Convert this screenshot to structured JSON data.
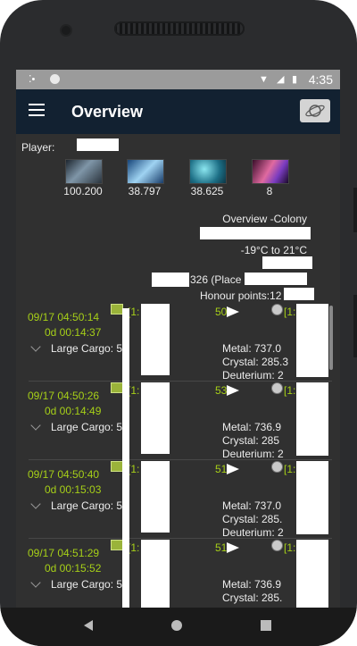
{
  "status_bar": {
    "time": "4:35"
  },
  "app_bar": {
    "title": "Overview"
  },
  "player": {
    "label": "Player:"
  },
  "resources": [
    {
      "name": "metal",
      "value": "100.200"
    },
    {
      "name": "crystal",
      "value": "38.797"
    },
    {
      "name": "deuterium",
      "value": "38.625"
    },
    {
      "name": "darkmatter",
      "value": "8"
    }
  ],
  "planet": {
    "name": "Overview -Colony",
    "temperature": "-19°C to 21°C",
    "points": "326 (Place",
    "honour_label": "Honour points:12"
  },
  "fleets": [
    {
      "arrival": "09/17 04:50:14",
      "timer": "0d 00:14:37",
      "coord_start": "[1:",
      "position": "50",
      "coord_dest": "[1:",
      "cargo": "Large Cargo: 5",
      "metal": "Metal: 737.0",
      "crystal": "Crystal: 285.3",
      "deuterium": "Deuterium: 2"
    },
    {
      "arrival": "09/17 04:50:26",
      "timer": "0d 00:14:49",
      "coord_start": "[1:",
      "position": "53",
      "coord_dest": "[1:",
      "cargo": "Large Cargo: 5",
      "metal": "Metal: 736.9",
      "crystal": "Crystal: 285",
      "deuterium": "Deuterium: 2"
    },
    {
      "arrival": "09/17 04:50:40",
      "timer": "0d 00:15:03",
      "coord_start": "[1:",
      "position": "51",
      "coord_dest": "[1:",
      "cargo": "Large Cargo: 5",
      "metal": "Metal: 737.0",
      "crystal": "Crystal: 285.",
      "deuterium": "Deuterium: 2"
    },
    {
      "arrival": "09/17 04:51:29",
      "timer": "0d 00:15:52",
      "coord_start": "[1:",
      "position": "51",
      "coord_dest": "[1:",
      "cargo": "Large Cargo: 5",
      "metal": "Metal: 736.9",
      "crystal": "Crystal: 285.",
      "deuterium": ""
    }
  ],
  "colors": {
    "app_bar": "#122131",
    "accent_green": "#a6cf18",
    "background": "#303030"
  },
  "icons": {
    "menu": "hamburger-icon",
    "planet": "planet-ring-icon",
    "ship": "ship-icon",
    "mission": "flag-icon",
    "destination": "moon-icon"
  }
}
